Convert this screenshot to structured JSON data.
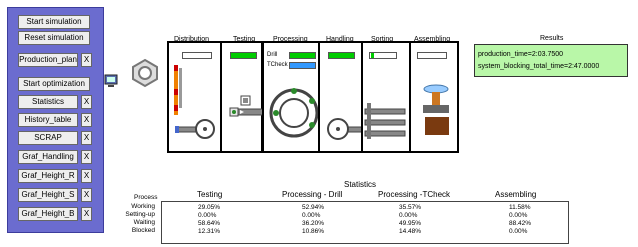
{
  "panel": {
    "buttons": {
      "start_sim": "Start simulation",
      "reset_sim": "Reset simulation",
      "production_plan": "Production_plan",
      "start_opt": "Start optimization",
      "statistics": "Statistics",
      "history_table": "History_table",
      "scrap": "SCRAP",
      "graf_handling": "Graf_Handling",
      "graf_height_r": "Graf_Height_R",
      "graf_height_s": "Graf_Height_S",
      "graf_height_b": "Graf_Height_B"
    },
    "close_label": "X"
  },
  "stations": {
    "distribution": "Distribution",
    "testing": "Testing",
    "processing": "Processing",
    "handling": "Handling",
    "sorting": "Sorting",
    "assembling": "Assembling",
    "drill": "Drill",
    "tcheck": "TCheck"
  },
  "results": {
    "title": "Results",
    "production_time": "production_time=2:03.7500",
    "blocking_time": "system_blocking_total_time=2:47.0000"
  },
  "statistics": {
    "title": "Statistics",
    "process_label": "Process",
    "columns": [
      "Testing",
      "Processing - Drill",
      "Processing -TCheck",
      "Assembling"
    ],
    "rows": [
      {
        "label": "Working",
        "values": [
          "29.05%",
          "52.94%",
          "35.57%",
          "11.58%"
        ]
      },
      {
        "label": "Setting-up",
        "values": [
          "0.00%",
          "0.00%",
          "0.00%",
          "0.00%"
        ]
      },
      {
        "label": "Waiting",
        "values": [
          "58.64%",
          "36.20%",
          "49.95%",
          "88.42%"
        ]
      },
      {
        "label": "Blocked",
        "values": [
          "12.31%",
          "10.86%",
          "14.48%",
          "0.00%"
        ]
      }
    ]
  }
}
